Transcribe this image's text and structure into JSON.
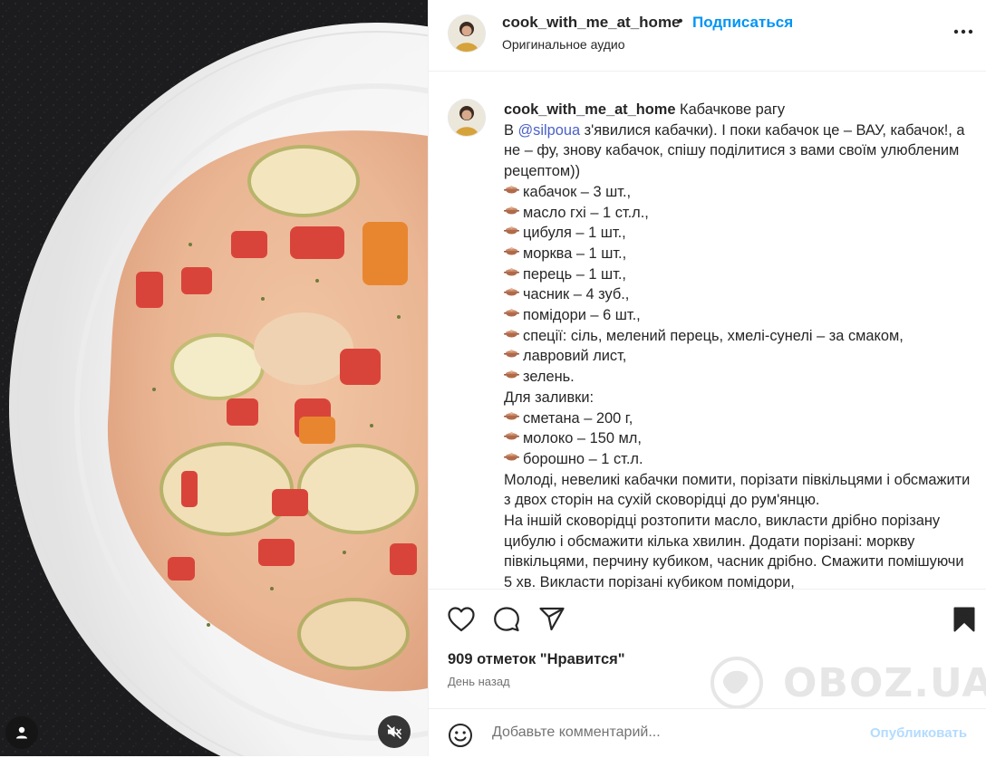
{
  "post": {
    "author": "cook_with_me_at_home",
    "follow_label": "Подписаться",
    "dot": "•",
    "audio_label": "Оригинальное аудио"
  },
  "caption": {
    "author": "cook_with_me_at_home",
    "title": " Кабачкове рагу",
    "intro_prefix": "В ",
    "mention": "@silpoua",
    "intro_rest": " з'явилися кабачки). І поки кабачок це – ВАУ, кабачок!, а не – фу, знову кабачок, спішу поділитися з вами своїм улюбленим рецептом))",
    "ingredients": [
      "кабачок – 3 шт.,",
      "масло гхі – 1 ст.л.,",
      "цибуля – 1 шт.,",
      "морква – 1 шт.,",
      "перець – 1 шт.,",
      "часник – 4 зуб.,",
      "помідори – 6 шт.,",
      "спеції: сіль, мелений перець, хмелі-сунелі – за смаком,",
      "лавровий лист,",
      "зелень."
    ],
    "filling_label": "Для заливки:",
    "filling": [
      "сметана – 200 г,",
      "молоко – 150 мл,",
      "борошно – 1 ст.л."
    ],
    "steps": [
      "Молоді, невеликі кабачки помити, порізати півкільцями і обсмажити з двох сторін на сухій сковорідці до рум'янцю.",
      "На іншій сковорідці розтопити масло, викласти дрібно порізану цибулю і обсмажити кілька хвилин. Додати порізані: моркву півкільцями, перчину кубиком, часник дрібно. Смажити помішуючи 5 хв. Викласти порізані кубиком помідори,"
    ]
  },
  "engagement": {
    "likes": "909 отметок \"Нравится\"",
    "time_ago": "День назад"
  },
  "comment": {
    "placeholder": "Добавьте комментарий...",
    "publish_label": "Опубликовать"
  },
  "watermark": {
    "text": "OBOZ.UA"
  },
  "icons": {
    "more": "more-horizontal-icon",
    "like": "heart-icon",
    "comment": "comment-icon",
    "share": "paper-plane-icon",
    "save": "bookmark-icon",
    "emoji": "smiley-icon",
    "mute": "speaker-muted-icon",
    "user_tag": "user-icon"
  },
  "colors": {
    "accent": "#0095f6",
    "text": "#262626",
    "muted": "#737373",
    "mention": "#4a61c6",
    "publish_disabled": "#b3dbff"
  }
}
